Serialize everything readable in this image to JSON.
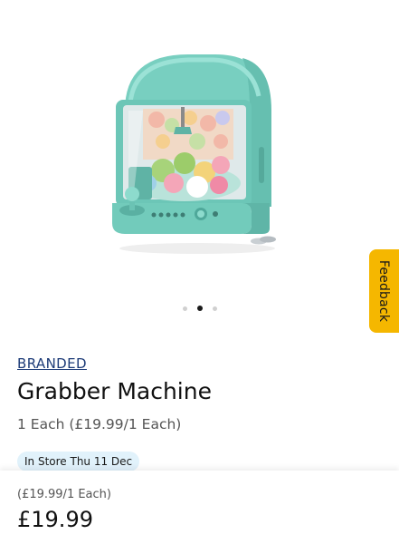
{
  "gallery": {
    "image_alt": "Grabber Machine",
    "dots": [
      {
        "active": false
      },
      {
        "active": true
      },
      {
        "active": false
      }
    ]
  },
  "feedback": {
    "label": "Feedback",
    "color": "#F5B700"
  },
  "product": {
    "brand": "BRANDED",
    "title": "Grabber Machine",
    "unit_price": "1 Each (£19.99/1 Each)",
    "availability_badge": "In Store Thu 11 Dec"
  },
  "price_bar": {
    "per_unit": "(£19.99/1 Each)",
    "price": "£19.99"
  },
  "colors": {
    "brand_link": "#1E3C78",
    "badge_bg": "#E1F2FB",
    "machine_body": "#7FD3C4"
  }
}
